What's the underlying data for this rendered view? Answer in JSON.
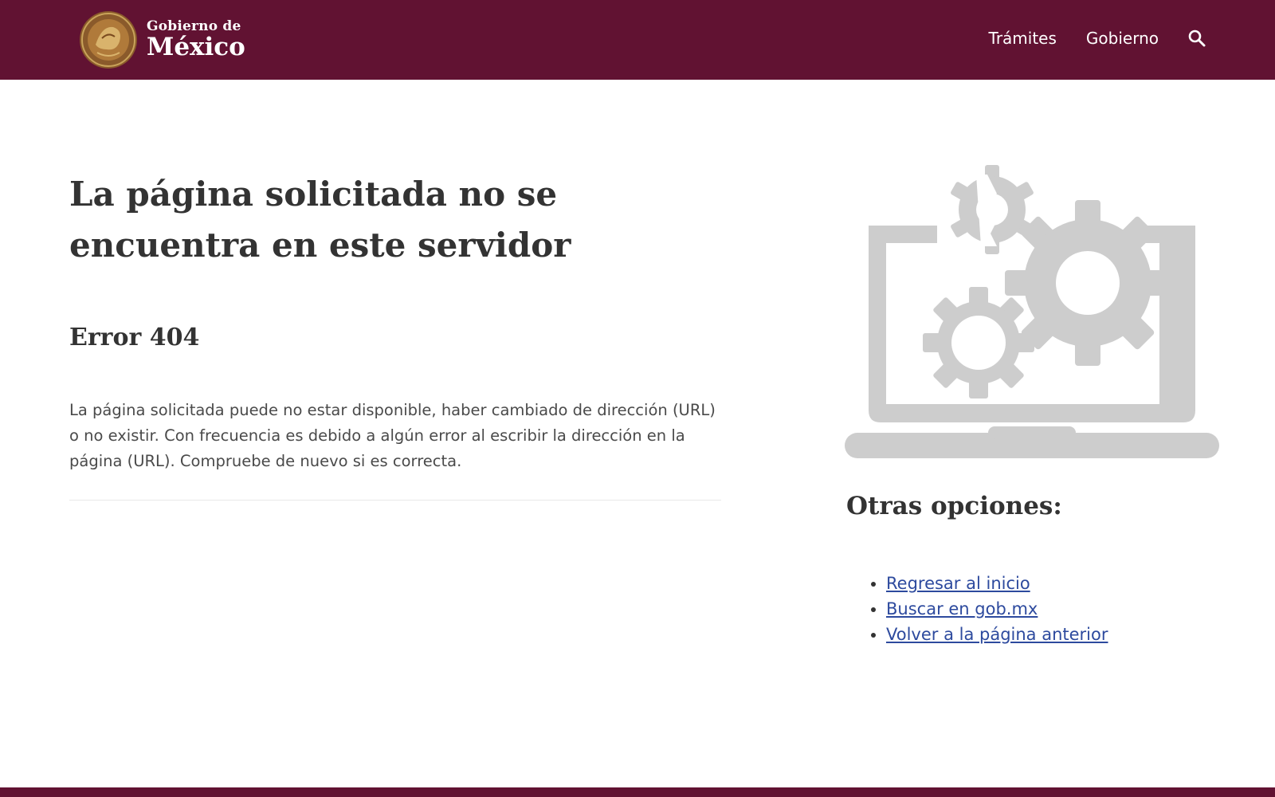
{
  "header": {
    "brand_small": "Gobierno de",
    "brand_big": "México",
    "nav": [
      {
        "label": "Trámites"
      },
      {
        "label": "Gobierno"
      }
    ],
    "search_icon": "search-icon",
    "seal_icon": "coat-of-arms-seal",
    "bar_color": "#611232"
  },
  "main": {
    "title": "La página solicitada no se encuentra en este servidor",
    "error_code": "Error 404",
    "description": "La página solicitada puede no estar disponible, haber cambiado de dirección (URL) o no existir. Con frecuencia es debido a algún error al escribir la dirección en la página (URL). Compruebe de nuevo si es correcta."
  },
  "sidebar": {
    "illustration_icon": "laptop-gears-icon",
    "options_title": "Otras opciones:",
    "options": [
      {
        "label": "Regresar al inicio"
      },
      {
        "label": "Buscar en gob.mx"
      },
      {
        "label": "Volver a la página anterior"
      }
    ],
    "link_color": "#2d4a9e"
  }
}
